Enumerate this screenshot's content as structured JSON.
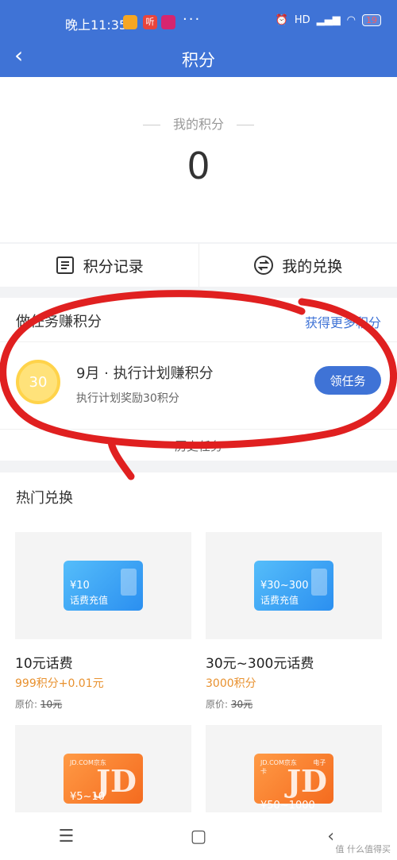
{
  "status": {
    "time": "晚上11:35",
    "right": "HD",
    "battery": "19",
    "app_badge": "听"
  },
  "header": {
    "title": "积分",
    "back": "‹"
  },
  "points": {
    "label": "我的积分",
    "value": "0"
  },
  "tabs": [
    {
      "label": "积分记录",
      "icon": "list-icon"
    },
    {
      "label": "我的兑换",
      "icon": "exchange-icon"
    }
  ],
  "tasks": {
    "title": "做任务赚积分",
    "more": "获得更多积分",
    "item": {
      "coin": "30",
      "title": "9月 · 执行计划赚积分",
      "desc": "执行计划奖励30积分",
      "button": "领任务"
    },
    "history": "历史任务"
  },
  "hot": {
    "title": "热门兑换",
    "items": [
      {
        "card_value": "¥10",
        "card_sub": "话费充值",
        "name": "10元话费",
        "price": "999积分+0.01元",
        "orig_label": "原价:",
        "orig": "10元"
      },
      {
        "card_value": "¥30~300",
        "card_sub": "话费充值",
        "name": "30元~300元话费",
        "price": "3000积分",
        "orig_label": "原价:",
        "orig": "30元"
      },
      {
        "card_value": "¥5~10",
        "card_brand": "JD.COM京东",
        "card_tag": "",
        "big": "JD"
      },
      {
        "card_value": "¥50~1000",
        "card_brand": "JD.COM京东",
        "card_tag": "电子卡",
        "big": "JD"
      }
    ]
  },
  "watermark": "值 什么值得买",
  "colors": {
    "primary": "#3f73d6",
    "price": "#e8912f",
    "annotation": "#e02020"
  }
}
